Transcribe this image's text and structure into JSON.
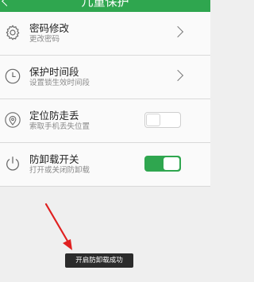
{
  "header": {
    "title": "儿童保护",
    "back_icon": "chevron-left-icon",
    "background": "#2fa64f"
  },
  "settings": [
    {
      "title": "密码修改",
      "subtitle": "更改密码",
      "icon": "gear-icon",
      "control": "chevron"
    },
    {
      "title": "保护时间段",
      "subtitle": "设置锁生效时间段",
      "icon": "clock-icon",
      "control": "chevron"
    },
    {
      "title": "定位防走丢",
      "subtitle": "索取手机丢失位置",
      "icon": "location-pin-icon",
      "control": "toggle",
      "enabled": false
    },
    {
      "title": "防卸载开关",
      "subtitle": "打开或关闭防卸载",
      "icon": "power-icon",
      "control": "toggle",
      "enabled": true
    }
  ],
  "toast": {
    "text": "开启防卸载成功"
  },
  "colors": {
    "accent": "#2fa64f",
    "annotation_arrow": "#e02020"
  }
}
